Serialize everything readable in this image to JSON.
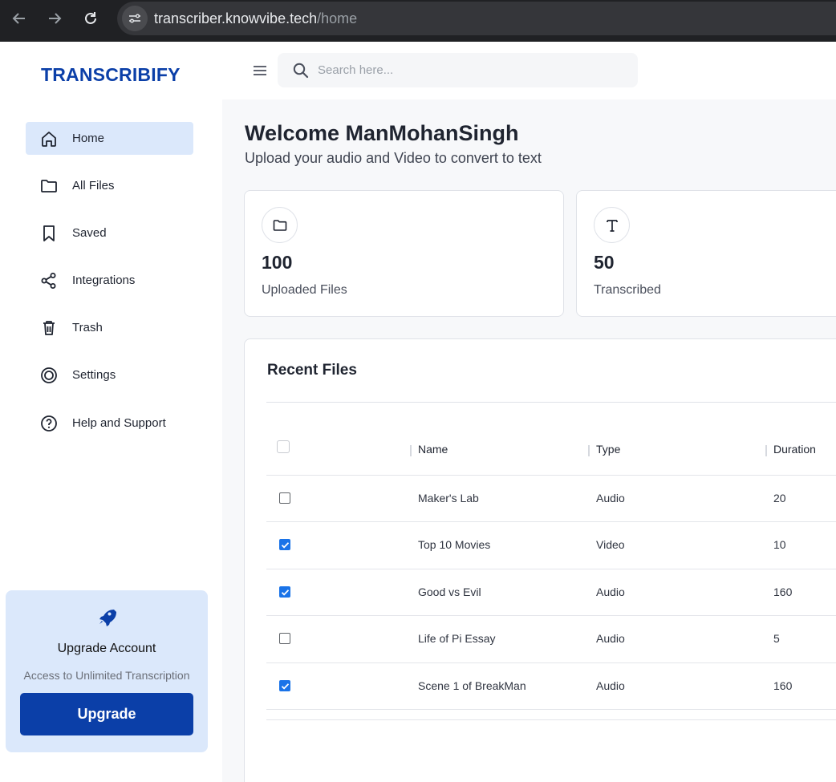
{
  "browser": {
    "url_host": "transcriber.knowvibe.tech",
    "url_path": "/home"
  },
  "sidebar": {
    "brand": "TRANSCRIBIFY",
    "items": [
      {
        "label": "Home",
        "icon": "home-icon",
        "active": true
      },
      {
        "label": "All Files",
        "icon": "folder-icon"
      },
      {
        "label": "Saved",
        "icon": "bookmark-icon"
      },
      {
        "label": "Integrations",
        "icon": "share-icon"
      },
      {
        "label": "Trash",
        "icon": "trash-icon"
      },
      {
        "label": "Settings",
        "icon": "gear-icon"
      },
      {
        "label": "Help and Support",
        "icon": "help-icon"
      }
    ],
    "upgrade": {
      "title": "Upgrade Account",
      "subtitle": "Access to Unlimited Transcription",
      "button": "Upgrade"
    }
  },
  "header": {
    "search_placeholder": "Search here..."
  },
  "main": {
    "welcome": "Welcome ManMohanSingh",
    "subtitle": "Upload your audio and Video to convert to text",
    "stats": [
      {
        "value": "100",
        "label": "Uploaded Files",
        "icon": "folder-icon"
      },
      {
        "value": "50",
        "label": "Transcribed",
        "icon": "text-icon"
      }
    ],
    "recent": {
      "title": "Recent Files",
      "columns": [
        "Name",
        "Type",
        "Duration"
      ],
      "rows": [
        {
          "checked": false,
          "name": "Maker's Lab",
          "type": "Audio",
          "duration": "20"
        },
        {
          "checked": true,
          "name": "Top 10 Movies",
          "type": "Video",
          "duration": "10"
        },
        {
          "checked": true,
          "name": "Good vs Evil",
          "type": "Audio",
          "duration": "160"
        },
        {
          "checked": false,
          "name": "Life of Pi Essay",
          "type": "Audio",
          "duration": "5"
        },
        {
          "checked": true,
          "name": "Scene 1 of BreakMan",
          "type": "Audio",
          "duration": "160"
        }
      ]
    }
  },
  "colors": {
    "brand": "#0b3fa8",
    "active_bg": "#dbe8fb",
    "checkbox": "#1a73e8"
  }
}
